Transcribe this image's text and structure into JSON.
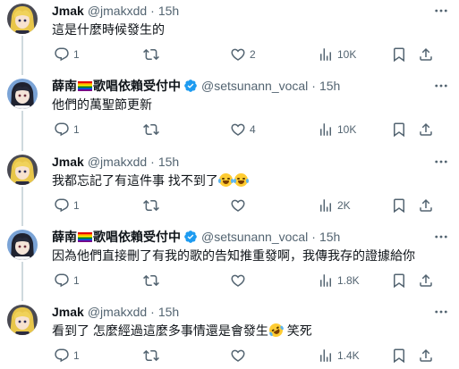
{
  "tweets": [
    {
      "name": "Jmak",
      "flag": false,
      "verified": false,
      "handle": "@jmakxdd",
      "dot": "·",
      "time": "15h",
      "text": "這是什麼時候發生的",
      "emoji": "",
      "text_after": "",
      "reply_count": "1",
      "retweet_count": "",
      "like_count": "2",
      "view_count": "10K",
      "avatar": "anime-blonde"
    },
    {
      "name": "薛南",
      "name_suffix": "歌唱依賴受付中",
      "flag": true,
      "verified": true,
      "handle": "@setsunann_vocal",
      "dot": "·",
      "time": "15h",
      "text": "他們的萬聖節更新",
      "emoji": "",
      "text_after": "",
      "reply_count": "1",
      "retweet_count": "",
      "like_count": "4",
      "view_count": "10K",
      "avatar": "anime-dark"
    },
    {
      "name": "Jmak",
      "flag": false,
      "verified": false,
      "handle": "@jmakxdd",
      "dot": "·",
      "time": "15h",
      "text": "我都忘記了有這件事 找不到了",
      "emoji": "crying-laughing",
      "text_after": "",
      "reply_count": "1",
      "retweet_count": "",
      "like_count": "",
      "view_count": "2K",
      "avatar": "anime-blonde"
    },
    {
      "name": "薛南",
      "name_suffix": "歌唱依賴受付中",
      "flag": true,
      "verified": true,
      "handle": "@setsunann_vocal",
      "dot": "·",
      "time": "15h",
      "text": "因為他們直接刪了有我的歌的告知推重發啊，我傳我存的證據給你",
      "emoji": "",
      "text_after": "",
      "reply_count": "1",
      "retweet_count": "",
      "like_count": "",
      "view_count": "1.8K",
      "avatar": "anime-dark"
    },
    {
      "name": "Jmak",
      "flag": false,
      "verified": false,
      "handle": "@jmakxdd",
      "dot": "·",
      "time": "15h",
      "text": "看到了 怎麼經過這麼多事情還是會發生",
      "emoji": "rolling-laughing",
      "text_after": " 笑死",
      "reply_count": "1",
      "retweet_count": "",
      "like_count": "",
      "view_count": "1.4K",
      "avatar": "anime-blonde"
    }
  ],
  "icons": {
    "reply": "reply-icon",
    "retweet": "retweet-icon",
    "like": "like-icon",
    "views": "views-icon",
    "bookmark": "bookmark-icon",
    "share": "share-icon",
    "more": "more-icon",
    "verified": "verified-icon"
  },
  "colors": {
    "muted": "#536471",
    "text": "#0f1419",
    "verified": "#1d9bf0",
    "thread_line": "#cfd9de"
  }
}
